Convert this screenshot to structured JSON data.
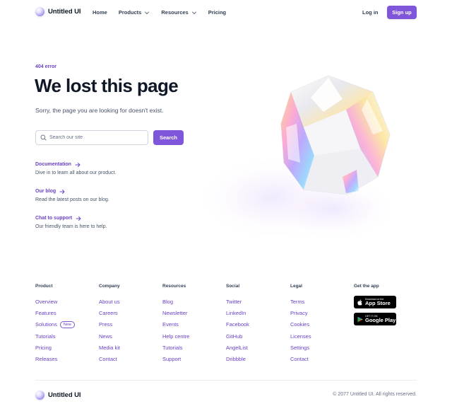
{
  "brand": {
    "name": "Untitled UI",
    "accent": "#7f56d9"
  },
  "nav": {
    "links": [
      {
        "label": "Home",
        "dropdown": false
      },
      {
        "label": "Products",
        "dropdown": true
      },
      {
        "label": "Resources",
        "dropdown": true
      },
      {
        "label": "Pricing",
        "dropdown": false
      }
    ],
    "login_label": "Log in",
    "signup_label": "Sign up"
  },
  "hero": {
    "eyebrow": "404 error",
    "title": "We lost this page",
    "subtitle": "Sorry, the page you are looking for doesn't exist.",
    "search_placeholder": "Search our site",
    "search_button": "Search",
    "links": [
      {
        "title": "Documentation",
        "desc": "Dive in to learn all about our product."
      },
      {
        "title": "Our blog",
        "desc": "Read the latest posts on our blog."
      },
      {
        "title": "Chat to support",
        "desc": "Our friendly team is here to help."
      }
    ]
  },
  "footer": {
    "columns": [
      {
        "title": "Product",
        "items": [
          "Overview",
          "Features",
          "Solutions",
          "Tutorials",
          "Pricing",
          "Releases"
        ]
      },
      {
        "title": "Company",
        "items": [
          "About us",
          "Careers",
          "Press",
          "News",
          "Media kit",
          "Contact"
        ]
      },
      {
        "title": "Resources",
        "items": [
          "Blog",
          "Newsletter",
          "Events",
          "Help centre",
          "Tutorials",
          "Support"
        ]
      },
      {
        "title": "Social",
        "items": [
          "Twitter",
          "LinkedIn",
          "Facebook",
          "GitHub",
          "AngelList",
          "Dribbble"
        ]
      },
      {
        "title": "Legal",
        "items": [
          "Terms",
          "Privacy",
          "Cookies",
          "Licenses",
          "Settings",
          "Contact"
        ]
      }
    ],
    "solutions_badge": "New",
    "get_app_title": "Get the app",
    "app_store": {
      "small": "Download on the",
      "big": "App Store",
      "icon": "apple-icon"
    },
    "google_play": {
      "small": "GET IT ON",
      "big": "Google Play",
      "icon": "google-play-icon"
    },
    "copyright": "© 2077 Untitled UI. All rights reserved."
  }
}
